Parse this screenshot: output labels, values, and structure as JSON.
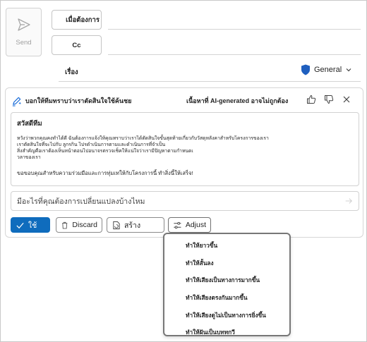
{
  "compose": {
    "send_label": "Send",
    "to_label": "เมื่อต้องการ",
    "cc_label": "Cc",
    "subject_label": "เรื่อง",
    "sensitivity_label": "General"
  },
  "copilot": {
    "prompt_title": "บอกให้ทีมทราบว่าเราตัดสินใจใช้ค้นชย",
    "ai_note": "เนื้อหาที่ AI-generated อาจไม่ถูกต้อง",
    "draft": {
      "greeting": "สวัสดีทีม",
      "body_lines": [
        "หวังว่าพวกคุณคงทำได้ดี ฉันต้องการแจ้งให้คุณทราบว่าเราได้ตัดสินใจขั้นสุดท้ายเกี่ยวกับวัสดุหลังคาสำหรับโครงการของเรา",
        "เราตัดสินใจที่จะไปกับ ลูกรกิน ไปรดำเนินการตามและดำเนินการที่จำเป็น",
        "สิ่งสำคัญคือเราต้องเห็นหน้าตอนไปอนาจรตรวจเช็คให้แน่ใจว่าเรามีปัญหาตามกำหนดเ",
        "วลาของเรา"
      ],
      "closing": "ขอขอบคุณสำหรับความร่วมมือและการทุ่มเทให้กับโครงการนี้ ทำสิ่งนี้ให้เสร็จ!"
    },
    "refine_placeholder": "มีอะไรที่คุณต้องการเปลี่ยนแปลงบ้างไหม",
    "buttons": {
      "keep": "ใช้",
      "discard": "Discard",
      "regenerate": "สร้าง",
      "adjust": "Adjust"
    }
  },
  "adjust_menu": [
    "ทำให้ยาวขึ้น",
    "ทำให้สั้นลง",
    "ทำให้เสียงเป็นทางการมากขึ้น",
    "ทำให้เสียงตรงกันมากขึ้น",
    "ทำให้เสียงดูไม่เป็นทางการยิ่งขึ้น",
    "ทำให้ฝันเป็นบททกวี"
  ],
  "colors": {
    "accent": "#0f6cbd",
    "shield": "#1f5fbf",
    "copilot_pen": "#1e6fd9"
  },
  "icons": [
    "send-icon",
    "shield-icon",
    "copilot-pen-icon",
    "thumbs-up-icon",
    "thumbs-down-icon",
    "close-icon",
    "chevron-down-icon",
    "check-icon",
    "trash-icon",
    "regenerate-icon",
    "sliders-icon",
    "arrow-right-icon"
  ]
}
